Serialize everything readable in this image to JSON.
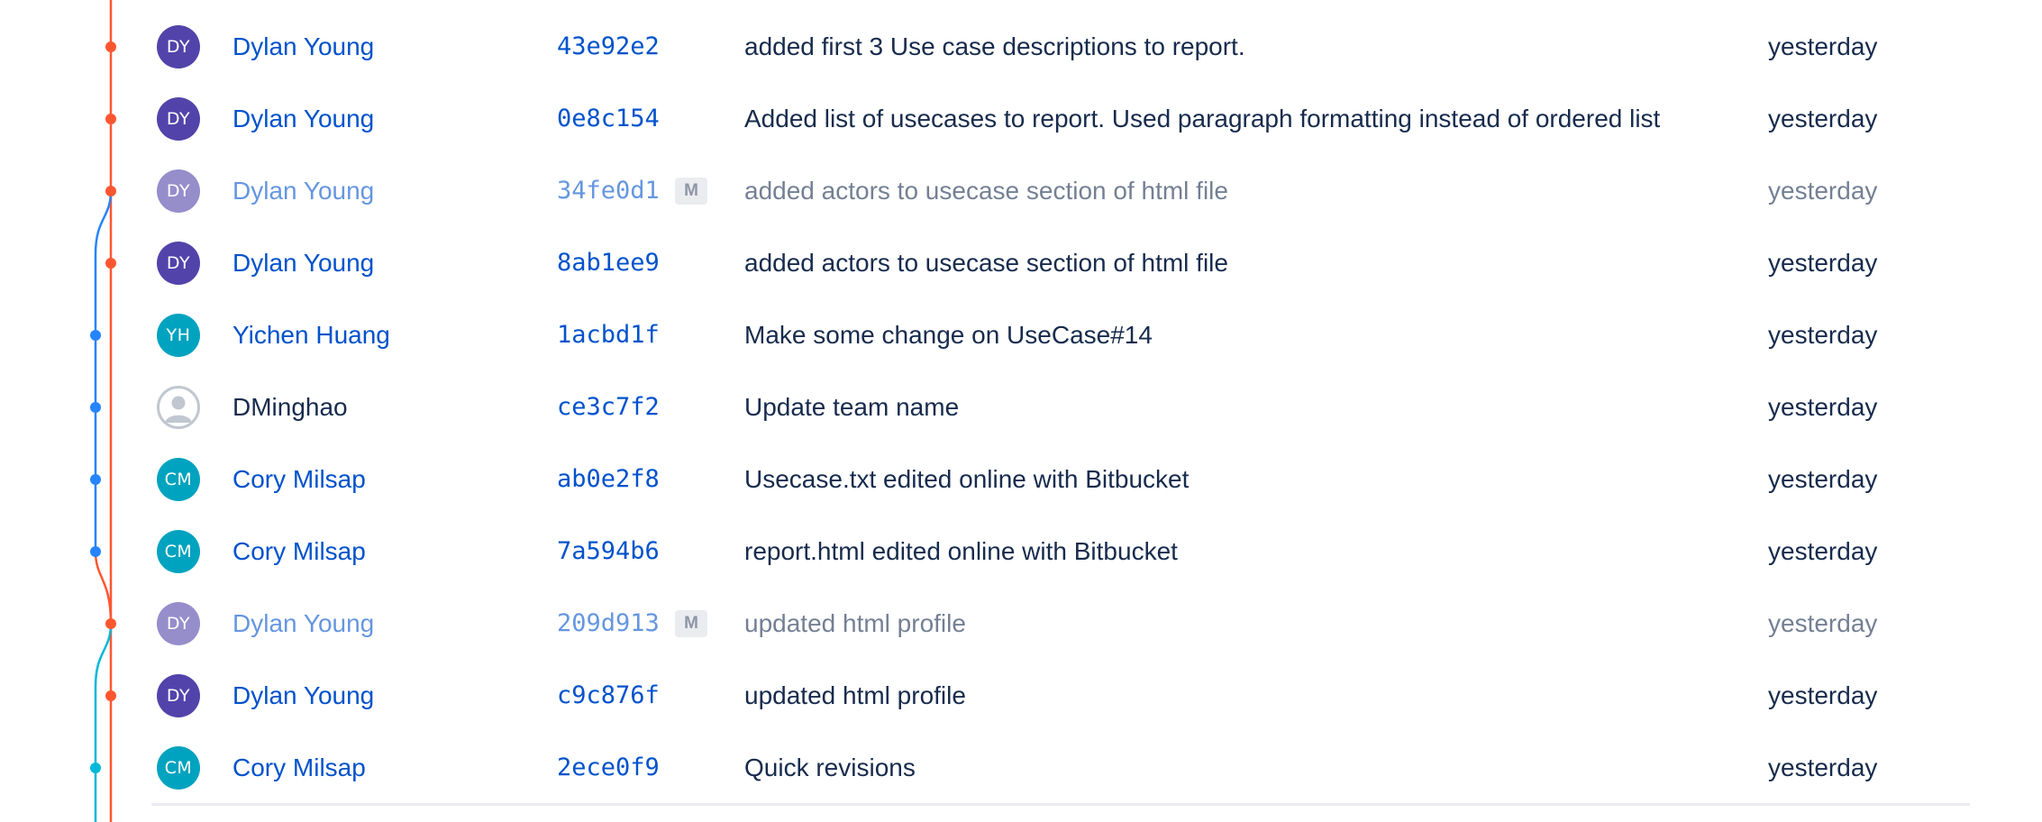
{
  "colors": {
    "link": "#0052cc",
    "text": "#172b4d",
    "branch_main": "#ff5630",
    "branch_blue": "#2684ff",
    "branch_teal": "#00b8d9",
    "avatar_purple": "#5243aa",
    "avatar_teal": "#00a3bf",
    "badge_bg": "#dfe1e6"
  },
  "commits": [
    {
      "initials": "DY",
      "avatar_color": "#5243aa",
      "author": "Dylan Young",
      "author_linked": true,
      "hash": "43e92e2",
      "merge": false,
      "badge": "",
      "message": "added first 3 Use case descriptions to report.",
      "date": "yesterday",
      "lane": "main"
    },
    {
      "initials": "DY",
      "avatar_color": "#5243aa",
      "author": "Dylan Young",
      "author_linked": true,
      "hash": "0e8c154",
      "merge": false,
      "badge": "",
      "message": "Added list of usecases to report. Used paragraph formatting instead of ordered list",
      "date": "yesterday",
      "lane": "main"
    },
    {
      "initials": "DY",
      "avatar_color": "#5243aa",
      "author": "Dylan Young",
      "author_linked": true,
      "hash": "34fe0d1",
      "merge": true,
      "badge": "M",
      "message": "added actors to usecase section of html file",
      "date": "yesterday",
      "lane": "main"
    },
    {
      "initials": "DY",
      "avatar_color": "#5243aa",
      "author": "Dylan Young",
      "author_linked": true,
      "hash": "8ab1ee9",
      "merge": false,
      "badge": "",
      "message": "added actors to usecase section of html file",
      "date": "yesterday",
      "lane": "main"
    },
    {
      "initials": "YH",
      "avatar_color": "#00a3bf",
      "author": "Yichen Huang",
      "author_linked": true,
      "hash": "1acbd1f",
      "merge": false,
      "badge": "",
      "message": "Make some change on UseCase#14",
      "date": "yesterday",
      "lane": "blue"
    },
    {
      "initials": "",
      "avatar_color": "",
      "author": "DMinghao",
      "author_linked": false,
      "hash": "ce3c7f2",
      "merge": false,
      "badge": "",
      "message": "Update team name",
      "date": "yesterday",
      "lane": "blue"
    },
    {
      "initials": "CM",
      "avatar_color": "#00a3bf",
      "author": "Cory Milsap",
      "author_linked": true,
      "hash": "ab0e2f8",
      "merge": false,
      "badge": "",
      "message": "Usecase.txt edited online with Bitbucket",
      "date": "yesterday",
      "lane": "blue"
    },
    {
      "initials": "CM",
      "avatar_color": "#00a3bf",
      "author": "Cory Milsap",
      "author_linked": true,
      "hash": "7a594b6",
      "merge": false,
      "badge": "",
      "message": "report.html edited online with Bitbucket",
      "date": "yesterday",
      "lane": "blue"
    },
    {
      "initials": "DY",
      "avatar_color": "#5243aa",
      "author": "Dylan Young",
      "author_linked": true,
      "hash": "209d913",
      "merge": true,
      "badge": "M",
      "message": "updated html profile",
      "date": "yesterday",
      "lane": "main"
    },
    {
      "initials": "DY",
      "avatar_color": "#5243aa",
      "author": "Dylan Young",
      "author_linked": true,
      "hash": "c9c876f",
      "merge": false,
      "badge": "",
      "message": "updated html profile",
      "date": "yesterday",
      "lane": "main"
    },
    {
      "initials": "CM",
      "avatar_color": "#00a3bf",
      "author": "Cory Milsap",
      "author_linked": true,
      "hash": "2ece0f9",
      "merge": false,
      "badge": "",
      "message": "Quick revisions",
      "date": "yesterday",
      "lane": "teal"
    }
  ]
}
